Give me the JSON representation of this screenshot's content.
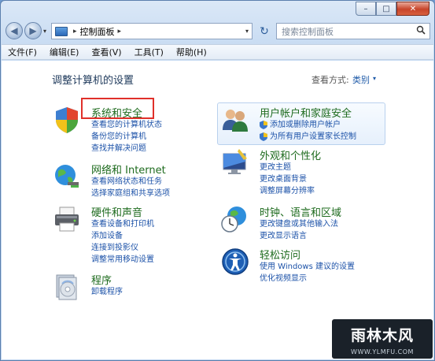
{
  "window": {
    "caption": {
      "min": "–",
      "max": "□",
      "close": "✕"
    }
  },
  "nav": {
    "back": "◀",
    "forward": "▶",
    "dropdown": "▾",
    "address_text": "控制面板",
    "address_sep": "▸",
    "refresh": "↻",
    "search_placeholder": "搜索控制面板",
    "search_icon": "search-icon"
  },
  "menu": [
    "文件(F)",
    "编辑(E)",
    "查看(V)",
    "工具(T)",
    "帮助(H)"
  ],
  "content": {
    "title": "调整计算机的设置",
    "view_label": "查看方式:",
    "view_value": "类别",
    "view_arrow": "▾"
  },
  "categories_left": [
    {
      "title": "系统和安全",
      "icon": "security-shield-icon",
      "links": [
        "查看您的计算机状态",
        "备份您的计算机",
        "查找并解决问题"
      ]
    },
    {
      "title": "网络和 Internet",
      "icon": "network-globe-icon",
      "links": [
        "查看网络状态和任务",
        "选择家庭组和共享选项"
      ]
    },
    {
      "title": "硬件和声音",
      "icon": "printer-icon",
      "links": [
        "查看设备和打印机",
        "添加设备",
        "连接到投影仪",
        "调整常用移动设置"
      ]
    },
    {
      "title": "程序",
      "icon": "programs-disc-icon",
      "links": [
        "卸载程序"
      ]
    }
  ],
  "categories_right": [
    {
      "title": "用户帐户和家庭安全",
      "icon": "users-icon",
      "links": [
        "添加或删除用户帐户",
        "为所有用户设置家长控制"
      ],
      "shield_links": true
    },
    {
      "title": "外观和个性化",
      "icon": "appearance-monitor-icon",
      "links": [
        "更改主题",
        "更改桌面背景",
        "调整屏幕分辨率"
      ]
    },
    {
      "title": "时钟、语言和区域",
      "icon": "clock-globe-icon",
      "links": [
        "更改键盘或其他输入法",
        "更改显示语言"
      ]
    },
    {
      "title": "轻松访问",
      "icon": "ease-of-access-icon",
      "links": [
        "使用 Windows 建议的设置",
        "优化视频显示"
      ]
    }
  ],
  "watermark": {
    "text": "雨林木风",
    "url": "WWW.YLMFU.COM"
  }
}
